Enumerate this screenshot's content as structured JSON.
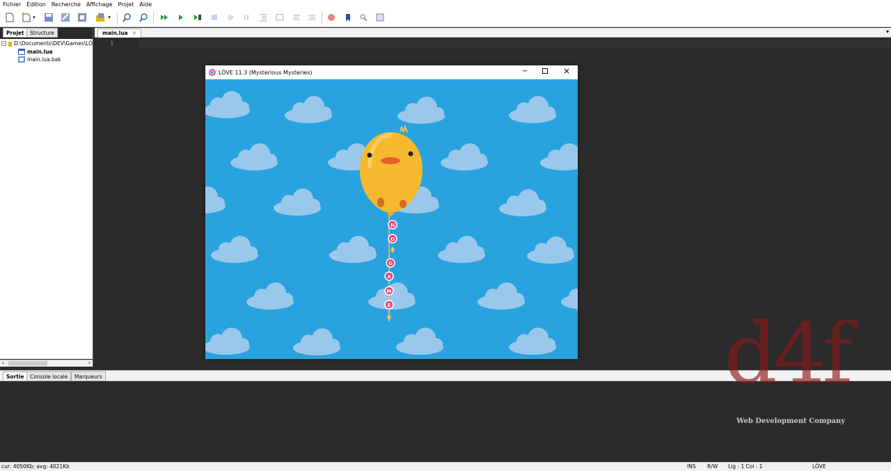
{
  "menubar": {
    "items": [
      "Fichier",
      "Édition",
      "Recherche",
      "Affichage",
      "Projet",
      "Aide"
    ]
  },
  "toolbar": {
    "icons": [
      "new-file-icon",
      "new-project-icon",
      "save-icon",
      "save-all-icon",
      "import-icon",
      "project-settings-icon",
      "find-icon",
      "find-in-files-icon",
      "run-project-icon",
      "run-icon",
      "run-file-icon",
      "stop-icon",
      "step-icon",
      "pause-icon",
      "indent-icon",
      "outdent-icon",
      "comment-icon",
      "uncomment-icon",
      "breakpoint-icon",
      "bookmark-icon",
      "find-replace-icon",
      "zoom-icon"
    ]
  },
  "left_panel": {
    "tabs": [
      "Projet",
      "Structure"
    ],
    "tree": {
      "root": "D:\\Documents\\DEV\\Games\\LÖ",
      "files": [
        "main.lua",
        "main.lua.bak"
      ]
    }
  },
  "editor": {
    "tab_label": "main.lua",
    "line_number": "1"
  },
  "love_window": {
    "title": "LÖVE 11.3 (Mysterious Mysteries)",
    "letters": [
      "N",
      "O",
      "G",
      "A",
      "M",
      "E"
    ]
  },
  "bottom_panel": {
    "tabs": [
      "Sortie",
      "Console locale",
      "Marqueurs"
    ]
  },
  "statusbar": {
    "memory": "cur: 4050Kb; avg: 4021Kb",
    "mode": "INS",
    "access": "R/W",
    "position": "Lig : 1 Col : 1",
    "interpreter": "LÖVE"
  },
  "watermark": {
    "logo": "d4f",
    "tagline": "Web Development Company"
  },
  "colors": {
    "sky": "#29a3df",
    "cloud": "#9ac8ea",
    "editor_bg": "#2b2b2b",
    "balloon": "#f6b92d",
    "bead": "#e6437e",
    "watermark": "#8b1a1a"
  }
}
